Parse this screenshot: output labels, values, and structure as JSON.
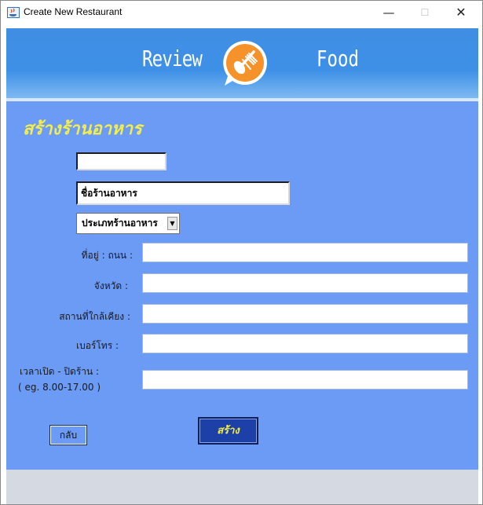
{
  "window": {
    "title": "Create New Restaurant"
  },
  "banner": {
    "left_text": "Review",
    "right_text": "Food"
  },
  "form": {
    "heading": "สร้างร้านอาหาร",
    "small_field_value": "",
    "name_field_value": "ชื่อร้านอาหาร",
    "type_select_value": "ประเภทร้านอาหาร",
    "labels": {
      "address": "ที่อยู่ : ถนน :",
      "province": "จังหวัด :",
      "nearby": "สถานที่ใกล้เคียง :",
      "phone": "เบอร์โทร :",
      "hours": "เวลาเปิด - ปิดร้าน :",
      "hours_hint": "( eg. 8.00-17.00 )"
    },
    "values": {
      "address": "",
      "province": "",
      "nearby": "",
      "phone": "",
      "hours": ""
    }
  },
  "buttons": {
    "back": "กลับ",
    "create": "สร้าง"
  },
  "icons": [
    "java-app-icon",
    "minimize-icon",
    "maximize-icon",
    "close-icon",
    "food-logo-icon",
    "dropdown-arrow-icon"
  ],
  "colors": {
    "banner": "#3f8ee4",
    "panel": "#6b9bf5",
    "heading": "#f3ee4a",
    "logo": "#f5922a",
    "create_button": "#1c3fa8",
    "footer": "#d5d9e2"
  }
}
